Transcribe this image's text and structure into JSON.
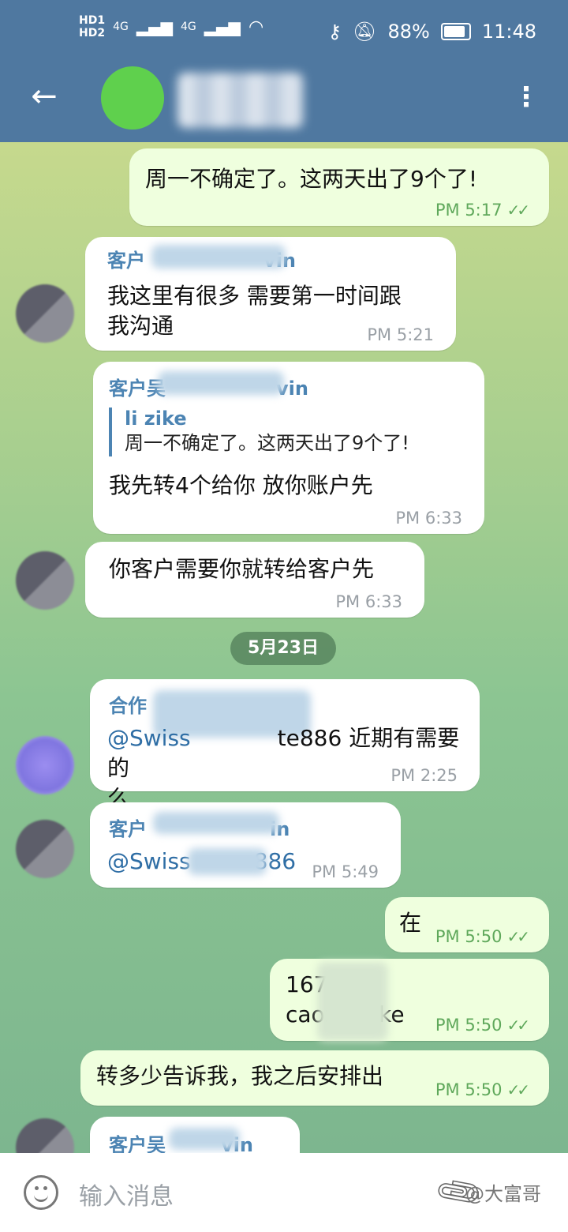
{
  "status_bar": {
    "hd1": "HD1",
    "hd2": "HD2",
    "net1": "4G",
    "net2": "4G",
    "battery": "88%",
    "time": "11:48"
  },
  "header": {
    "contact_name": ""
  },
  "messages": {
    "m1": {
      "text": "周一不确定了。这两天出了9个了!",
      "time": "PM 5:17"
    },
    "m2": {
      "sender": "客户",
      "sender_tail": "vin",
      "text_line1": "我这里有很多 需要第一时间跟",
      "text_line2": "我沟通",
      "time": "PM 5:21"
    },
    "m3": {
      "sender": "客户吴",
      "sender_tail": "vin",
      "reply_author": "li zike",
      "reply_text": "周一不确定了。这两天出了9个了!",
      "text": "我先转4个给你  放你账户先",
      "time": "PM 6:33"
    },
    "m4": {
      "text": "你客户需要你就转给客户先",
      "time": "PM 6:33"
    },
    "date_pill": "5月23日",
    "m5": {
      "sender": "合作",
      "text_line1a": "@Swiss",
      "text_line1b": "te886 近期有需要的",
      "text_line2": "么",
      "time": "PM 2:25"
    },
    "m6": {
      "sender": "客户",
      "sender_tail": "in",
      "text_a": "@Swiss",
      "text_b": "886",
      "time": "PM 5:49"
    },
    "m7": {
      "text": "在",
      "time": "PM 5:50"
    },
    "m8": {
      "text_line1": "167",
      "text_line1b": "4",
      "text_line2a": "caoz",
      "text_line2b": "gke",
      "time": "PM 5:50"
    },
    "m9": {
      "text": "转多少告诉我，我之后安排出",
      "time": "PM 5:50"
    },
    "m10": {
      "sender": "客户吴",
      "sender_tail": "vin"
    }
  },
  "input": {
    "placeholder": "输入消息",
    "watermark": "@大富哥"
  },
  "colors": {
    "header": "#4f78a0",
    "outgoing_bubble": "#efffde",
    "sender_name": "#4c84b3",
    "check": "#5fa85b"
  },
  "icons": {
    "back": "arrow-left-icon",
    "menu": "more-vertical-icon",
    "emoji": "emoji-icon",
    "attach": "paperclip-icon"
  }
}
